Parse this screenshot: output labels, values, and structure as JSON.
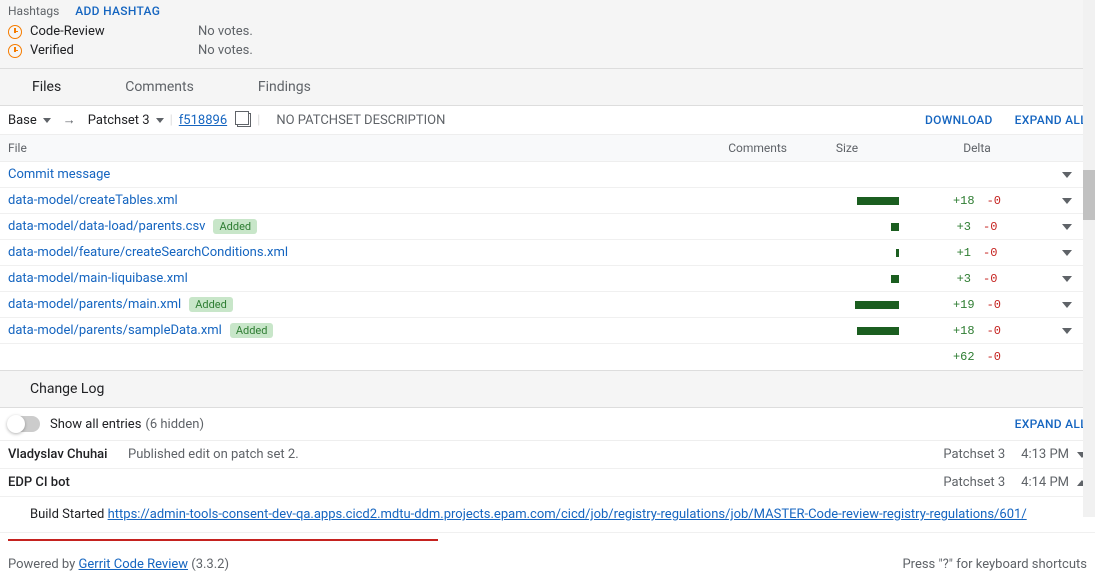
{
  "top": {
    "hashtags_label": "Hashtags",
    "add_hashtag": "ADD HASHTAG",
    "labels": [
      {
        "name": "Code-Review",
        "status": "No votes."
      },
      {
        "name": "Verified",
        "status": "No votes."
      }
    ]
  },
  "tabs": [
    "Files",
    "Comments",
    "Findings"
  ],
  "files_header": {
    "base": "Base",
    "patchset": "Patchset 3",
    "sha": "f518896",
    "no_desc": "NO PATCHSET DESCRIPTION",
    "download": "DOWNLOAD",
    "expand_all": "EXPAND ALL"
  },
  "columns": {
    "file": "File",
    "comments": "Comments",
    "size": "Size",
    "delta": "Delta"
  },
  "files": [
    {
      "name": "Commit message",
      "badge": null,
      "bar": 0,
      "add": "",
      "rem": ""
    },
    {
      "name": "data-model/createTables.xml",
      "badge": null,
      "bar": 42,
      "add": "+18",
      "rem": "-0"
    },
    {
      "name": "data-model/data-load/parents.csv",
      "badge": "Added",
      "bar": 8,
      "add": "+3",
      "rem": "-0"
    },
    {
      "name": "data-model/feature/createSearchConditions.xml",
      "badge": null,
      "bar": 3,
      "add": "+1",
      "rem": "-0"
    },
    {
      "name": "data-model/main-liquibase.xml",
      "badge": null,
      "bar": 8,
      "add": "+3",
      "rem": "-0"
    },
    {
      "name": "data-model/parents/main.xml",
      "badge": "Added",
      "bar": 44,
      "add": "+19",
      "rem": "-0"
    },
    {
      "name": "data-model/parents/sampleData.xml",
      "badge": "Added",
      "bar": 42,
      "add": "+18",
      "rem": "-0"
    }
  ],
  "totals": {
    "add": "+62",
    "rem": "-0"
  },
  "changelog": {
    "title": "Change Log",
    "show_all": "Show all entries",
    "hidden": "(6 hidden)",
    "expand_all": "EXPAND ALL",
    "entries": [
      {
        "author": "Vladyslav Chuhai",
        "msg": "Published edit on patch set 2.",
        "patchset": "Patchset 3",
        "time": "4:13 PM",
        "expanded": false
      },
      {
        "author": "EDP CI bot",
        "msg": "",
        "patchset": "Patchset 3",
        "time": "4:14 PM",
        "expanded": true
      }
    ],
    "build_started": "Build Started ",
    "build_link": "https://admin-tools-consent-dev-qa.apps.cicd2.mdtu-ddm.projects.epam.com/cicd/job/registry-regulations/job/MASTER-Code-review-registry-regulations/601/"
  },
  "footer": {
    "powered": "Powered by ",
    "product": "Gerrit Code Review",
    "version": " (3.3.2)",
    "shortcuts": "Press \"?\" for keyboard shortcuts"
  }
}
